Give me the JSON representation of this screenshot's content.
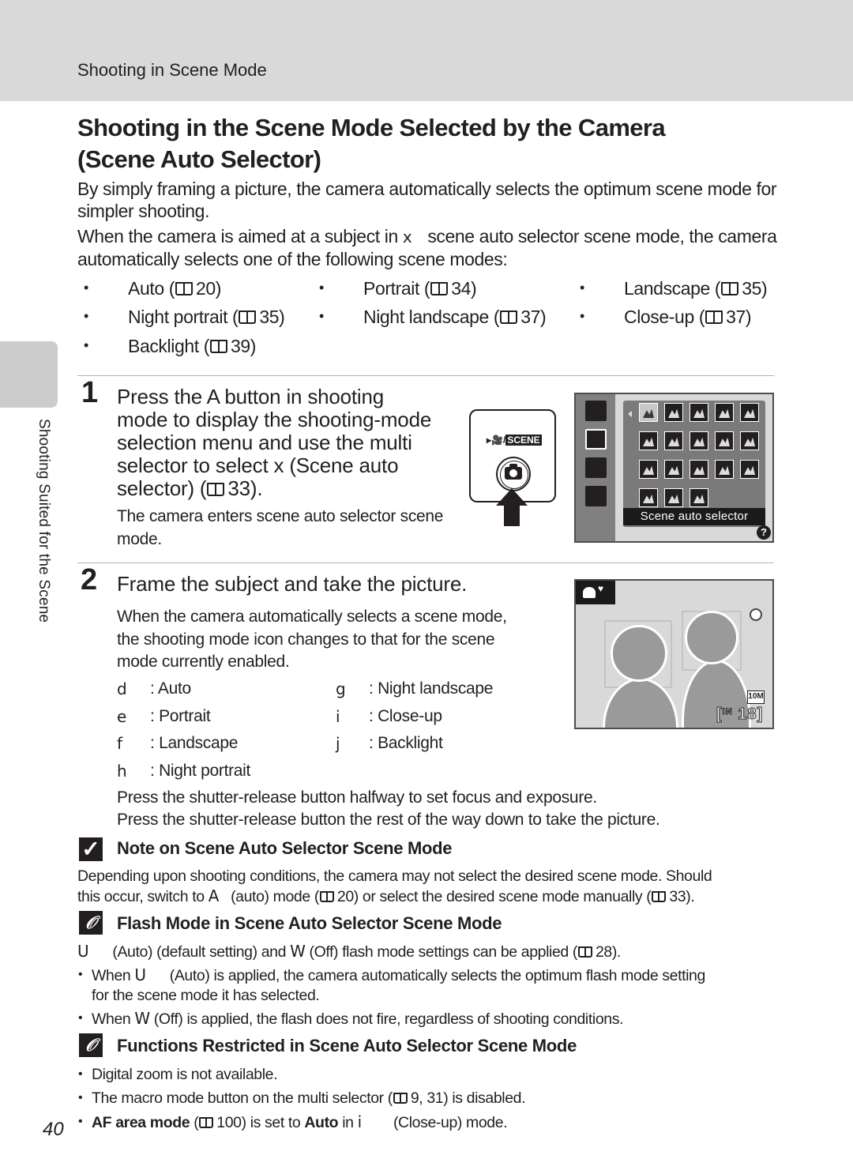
{
  "header": {
    "section_title": "Shooting in Scene Mode"
  },
  "side_tab": {
    "label": "Shooting Suited for the Scene"
  },
  "page": {
    "title_line1": "Shooting in the Scene Mode Selected by the Camera",
    "title_line2": "(Scene Auto Selector)",
    "page_number": "40"
  },
  "intro": {
    "para1": "By simply framing a picture, the camera automatically selects the optimum scene mode for simpler shooting.",
    "para2_before": "When the camera is aimed at a subject in",
    "para2_glyph": "x",
    "para2_after": "scene auto selector scene mode, the camera automatically selects one of the following scene modes:"
  },
  "scene_modes": [
    {
      "label": "Auto (",
      "page": "20)"
    },
    {
      "label": "Portrait (",
      "page": "34)"
    },
    {
      "label": "Landscape (",
      "page": "35)"
    },
    {
      "label": "Night portrait (",
      "page": "35)"
    },
    {
      "label": "Night landscape (",
      "page": "37)"
    },
    {
      "label": "Close-up (",
      "page": "37)"
    },
    {
      "label": "Backlight (",
      "page": "39)"
    }
  ],
  "step1": {
    "number": "1",
    "heading_l1": "Press the A   button in shooting",
    "heading_l2": "mode to display the shooting-mode",
    "heading_l3": "selection menu and use the multi",
    "heading_l4": "selector to select x   (Scene auto",
    "heading_l5a": "selector) (",
    "heading_l5b": "33).",
    "body_l1": "The camera enters scene auto selector scene",
    "body_l2": "mode.",
    "button_illustration": {
      "label_movie": "▸🎥/",
      "label_scene": "SCENE",
      "icon": "camera-icon"
    },
    "menu_screen": {
      "caption": "Scene auto selector",
      "help": "?"
    }
  },
  "step2": {
    "number": "2",
    "heading": "Frame the subject and take the picture.",
    "body_l1": "When the camera automatically selects a scene mode,",
    "body_l2": "the shooting mode icon changes to that for the scene",
    "body_l3": "mode currently enabled.",
    "legend": [
      {
        "key": "d",
        "value": ": Auto"
      },
      {
        "key": "e",
        "value": ": Portrait"
      },
      {
        "key": "f",
        "value": ": Landscape"
      },
      {
        "key": "h",
        "value": ": Night portrait"
      },
      {
        "key": "g",
        "value": ": Night landscape"
      },
      {
        "key": "i",
        "value": ": Close-up"
      },
      {
        "key": "j",
        "value": ": Backlight"
      }
    ],
    "press_half": "Press the shutter-release button halfway to set focus and exposure.",
    "press_full": "Press the shutter-release button the rest of the way down to take the picture.",
    "live_screen": {
      "image_size": "10M",
      "memory": "IN",
      "shots_remaining": "18"
    }
  },
  "note1": {
    "icon": "check-icon",
    "title": "Note on Scene Auto Selector Scene Mode",
    "line1": "Depending upon shooting conditions, the camera may not select the desired scene mode. Should",
    "line2_a": "this occur, switch to",
    "line2_glyph": "A",
    "line2_b": "(auto) mode (",
    "line2_c": "20) or select the desired scene mode manually (",
    "line2_d": "33)."
  },
  "note2": {
    "icon": "paperclip-icon",
    "title": "Flash Mode in Scene Auto Selector Scene Mode",
    "line1_glyph": "U",
    "line1_a": "(Auto) (default setting) and",
    "line1_glyph2": "W",
    "line1_b": "(Off) flash mode settings can be applied (",
    "line1_c": "28).",
    "bullet1_a": "When",
    "bullet1_glyph": "U",
    "bullet1_b": "(Auto) is applied, the camera automatically selects the optimum flash mode setting",
    "bullet1_c": "for the scene mode it has selected.",
    "bullet2_a": "When",
    "bullet2_glyph": "W",
    "bullet2_b": "(Off) is applied, the flash does not fire, regardless of shooting conditions."
  },
  "note3": {
    "icon": "paperclip-icon",
    "title": "Functions Restricted in Scene Auto Selector Scene Mode",
    "bullet1": "Digital zoom is not available.",
    "bullet2_a": "The macro mode button on the multi selector (",
    "bullet2_b": "9, 31) is disabled.",
    "bullet3_bold1": "AF area mode",
    "bullet3_a": "(",
    "bullet3_b": "100) is set to",
    "bullet3_bold2": "Auto",
    "bullet3_c": "in",
    "bullet3_glyph": "i",
    "bullet3_d": "(Close-up) mode."
  }
}
